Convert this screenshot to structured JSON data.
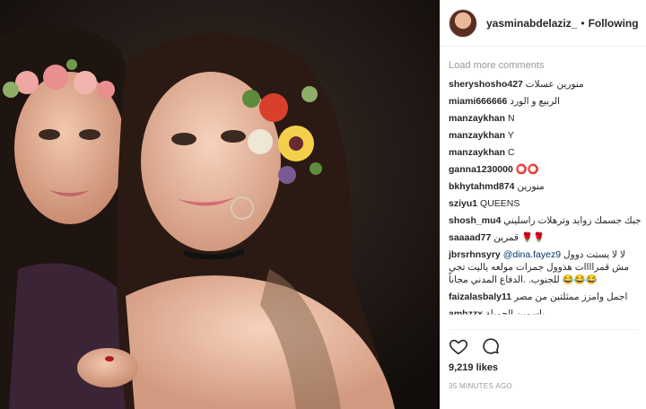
{
  "post": {
    "username": "yasminabdelaziz_",
    "separator": "•",
    "follow_status": "Following",
    "load_more": "Load more comments",
    "likes": "9,219 likes",
    "timestamp": "35 MINUTES AGO"
  },
  "comments": [
    {
      "user": "sheryshosho427",
      "text": "منورين عسلات"
    },
    {
      "user": "miami666666",
      "text": "الربيع و الورد"
    },
    {
      "user": "manzaykhan",
      "text": "N"
    },
    {
      "user": "manzaykhan",
      "text": "Y"
    },
    {
      "user": "manzaykhan",
      "text": "C"
    },
    {
      "user": "ganna1230000",
      "text": "⭕⭕"
    },
    {
      "user": "bkhytahmd874",
      "text": "منورين"
    },
    {
      "user": "sziyu1",
      "text": "QUEENS"
    },
    {
      "user": "shosh_mu4",
      "text": "مو عاجبك جسمك زوايد وترهلات راسليني"
    },
    {
      "user": "saaaad77",
      "text": "قمرين 🌹🌹"
    },
    {
      "user": "jbrsrhnsyry",
      "mention": "@dina.fayez9",
      "text": "لا لا يستت دوول مش قمراااات هذوول جمرات مولعه ياليت تجي للجنوب. .الدفاع المدني مجاناً 😂😂😂"
    },
    {
      "user": "faizalasbaly11",
      "text": "اجمل وامزز ممثلتين من مصر"
    },
    {
      "user": "amhzzx",
      "text": "ياسمين الجميلة"
    }
  ],
  "icons": {
    "like": "heart-outline-icon",
    "comment": "speech-bubble-icon"
  },
  "colors": {
    "text": "#262626",
    "muted": "#999999",
    "border": "#efefef",
    "mention": "#003569"
  }
}
